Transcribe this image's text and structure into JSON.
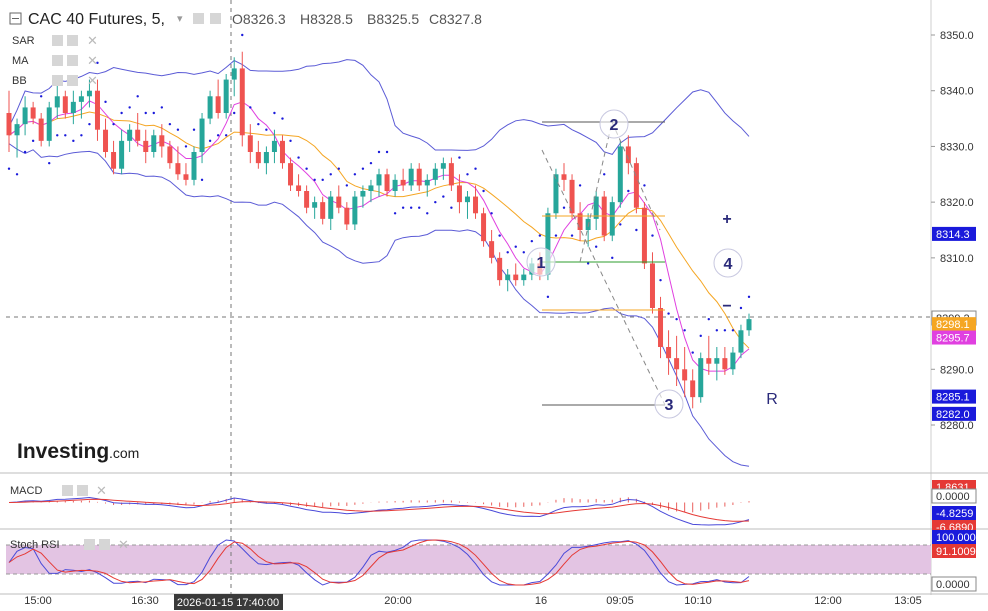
{
  "header": {
    "symbol": "CAC 40 Futures, 5,",
    "open": "O8326.3",
    "high": "H8328.5",
    "bid": "B8325.5",
    "close": "C8327.8"
  },
  "indicators": {
    "sar": "SAR",
    "ma": "MA",
    "bb": "BB",
    "macd": "MACD",
    "stoch": "Stoch RSI"
  },
  "logo": {
    "brand": "Investing",
    "suffix": ".com"
  },
  "price_axis": {
    "ticks": [
      "8350.0",
      "8340.0",
      "8330.0",
      "8320.0",
      "8310.0",
      "8290.0",
      "8280.0"
    ],
    "tick_values": [
      8350,
      8340,
      8330,
      8320,
      8310,
      8290,
      8280
    ],
    "tags": [
      {
        "label": "8314.3",
        "value": 8314.3,
        "color": "#1a1adb"
      },
      {
        "label": "8299.2",
        "value": 8299.2,
        "color": "#ffffff",
        "text": "#333333"
      },
      {
        "label": "8298.1",
        "value": 8298.1,
        "color": "#f5a623"
      },
      {
        "label": "8295.7",
        "value": 8295.7,
        "color": "#e040e0"
      },
      {
        "label": "8285.1",
        "value": 8285.1,
        "color": "#1a1adb"
      },
      {
        "label": "8282.0",
        "value": 8282.0,
        "color": "#1a1adb"
      }
    ]
  },
  "macd_axis": {
    "tags": [
      {
        "label": "1.8631",
        "color": "#e53935"
      },
      {
        "label": "0.0000",
        "color": "#ffffff",
        "text": "#333333"
      },
      {
        "label": "-4.8259",
        "color": "#1a1adb"
      },
      {
        "label": "-6.6890",
        "color": "#e53935"
      }
    ]
  },
  "stoch_axis": {
    "tags": [
      {
        "label": "100.0000",
        "color": "#1a1adb"
      },
      {
        "label": "91.1009",
        "color": "#e53935"
      },
      {
        "label": "0.0000",
        "color": "#ffffff",
        "text": "#333333"
      }
    ]
  },
  "time_axis": {
    "labels": [
      "15:00",
      "16:30",
      "18:00",
      "20:00",
      "16",
      "09:05",
      "10:10",
      "12:00",
      "13:05"
    ],
    "crosshair_label": "2026-01-15 17:40:00"
  },
  "annotations": {
    "wave_labels": [
      "1",
      "2",
      "3",
      "4"
    ],
    "plus": "+",
    "minus": "−",
    "r": "R"
  },
  "colors": {
    "up": "#26a69a",
    "down": "#ef5350",
    "bb": "#5b5bd6",
    "ma_orange": "#f5a623",
    "ma_pink": "#e040e0",
    "sar": "#1a1adb",
    "macd_line": "#4a4ad9",
    "signal_line": "#e53935",
    "stoch_fill": "#e3c4e3"
  },
  "chart_data": {
    "type": "candlestick",
    "y_range": [
      8274,
      8355
    ],
    "candles": [
      [
        8336,
        8340,
        8329,
        8332
      ],
      [
        8332,
        8335,
        8328,
        8334
      ],
      [
        8334,
        8339,
        8332,
        8337
      ],
      [
        8337,
        8338,
        8334,
        8335
      ],
      [
        8335,
        8336,
        8330,
        8331
      ],
      [
        8331,
        8338,
        8330,
        8337
      ],
      [
        8337,
        8341,
        8335,
        8339
      ],
      [
        8339,
        8340,
        8335,
        8336
      ],
      [
        8336,
        8340,
        8334,
        8338
      ],
      [
        8338,
        8340,
        8335,
        8339
      ],
      [
        8339,
        8342,
        8337,
        8340
      ],
      [
        8340,
        8342,
        8331,
        8333
      ],
      [
        8333,
        8335,
        8328,
        8329
      ],
      [
        8329,
        8331,
        8325,
        8326
      ],
      [
        8326,
        8333,
        8325,
        8331
      ],
      [
        8331,
        8334,
        8329,
        8333
      ],
      [
        8333,
        8336,
        8330,
        8331
      ],
      [
        8331,
        8333,
        8327,
        8329
      ],
      [
        8329,
        8333,
        8328,
        8332
      ],
      [
        8332,
        8334,
        8328,
        8330
      ],
      [
        8330,
        8331,
        8326,
        8327
      ],
      [
        8327,
        8330,
        8324,
        8325
      ],
      [
        8325,
        8327,
        8323,
        8324
      ],
      [
        8324,
        8330,
        8323,
        8329
      ],
      [
        8329,
        8336,
        8327,
        8335
      ],
      [
        8335,
        8340,
        8334,
        8339
      ],
      [
        8339,
        8342,
        8335,
        8336
      ],
      [
        8336,
        8343,
        8335,
        8342
      ],
      [
        8342,
        8346,
        8339,
        8344
      ],
      [
        8344,
        8347,
        8330,
        8332
      ],
      [
        8332,
        8334,
        8327,
        8329
      ],
      [
        8329,
        8331,
        8326,
        8327
      ],
      [
        8327,
        8330,
        8325,
        8329
      ],
      [
        8329,
        8333,
        8327,
        8331
      ],
      [
        8331,
        8332,
        8326,
        8327
      ],
      [
        8327,
        8328,
        8322,
        8323
      ],
      [
        8323,
        8325,
        8321,
        8322
      ],
      [
        8322,
        8323,
        8318,
        8319
      ],
      [
        8319,
        8321,
        8317,
        8320
      ],
      [
        8320,
        8321,
        8316,
        8317
      ],
      [
        8317,
        8322,
        8315,
        8321
      ],
      [
        8321,
        8323,
        8318,
        8319
      ],
      [
        8319,
        8320,
        8315,
        8316
      ],
      [
        8316,
        8322,
        8315,
        8321
      ],
      [
        8321,
        8323,
        8319,
        8322
      ],
      [
        8322,
        8324,
        8320,
        8323
      ],
      [
        8323,
        8326,
        8321,
        8325
      ],
      [
        8325,
        8326,
        8321,
        8322
      ],
      [
        8322,
        8325,
        8321,
        8324
      ],
      [
        8324,
        8326,
        8322,
        8323
      ],
      [
        8323,
        8327,
        8322,
        8326
      ],
      [
        8326,
        8327,
        8322,
        8323
      ],
      [
        8323,
        8325,
        8321,
        8324
      ],
      [
        8324,
        8327,
        8323,
        8326
      ],
      [
        8326,
        8328,
        8324,
        8327
      ],
      [
        8327,
        8328,
        8322,
        8323
      ],
      [
        8323,
        8325,
        8318,
        8320
      ],
      [
        8320,
        8322,
        8317,
        8321
      ],
      [
        8321,
        8323,
        8317,
        8318
      ],
      [
        8318,
        8319,
        8312,
        8313
      ],
      [
        8313,
        8315,
        8309,
        8310
      ],
      [
        8310,
        8311,
        8305,
        8306
      ],
      [
        8306,
        8308,
        8304,
        8307
      ],
      [
        8307,
        8309,
        8305,
        8306
      ],
      [
        8306,
        8308,
        8305,
        8307
      ],
      [
        8307,
        8310,
        8306,
        8309
      ],
      [
        8309,
        8311,
        8306,
        8307
      ],
      [
        8307,
        8319,
        8306,
        8318
      ],
      [
        8318,
        8326,
        8317,
        8325
      ],
      [
        8325,
        8327,
        8322,
        8324
      ],
      [
        8324,
        8325,
        8317,
        8318
      ],
      [
        8318,
        8320,
        8313,
        8315
      ],
      [
        8315,
        8318,
        8312,
        8317
      ],
      [
        8317,
        8322,
        8315,
        8321
      ],
      [
        8321,
        8322,
        8313,
        8314
      ],
      [
        8314,
        8321,
        8313,
        8320
      ],
      [
        8320,
        8331,
        8319,
        8330
      ],
      [
        8330,
        8332,
        8325,
        8327
      ],
      [
        8327,
        8328,
        8318,
        8319
      ],
      [
        8319,
        8320,
        8308,
        8309
      ],
      [
        8309,
        8311,
        8300,
        8301
      ],
      [
        8301,
        8303,
        8292,
        8294
      ],
      [
        8294,
        8297,
        8289,
        8292
      ],
      [
        8292,
        8296,
        8287,
        8290
      ],
      [
        8290,
        8294,
        8285,
        8288
      ],
      [
        8288,
        8290,
        8283,
        8285
      ],
      [
        8285,
        8293,
        8284,
        8292
      ],
      [
        8292,
        8296,
        8289,
        8291
      ],
      [
        8291,
        8294,
        8288,
        8292
      ],
      [
        8292,
        8294,
        8289,
        8290
      ],
      [
        8290,
        8294,
        8289,
        8293
      ],
      [
        8293,
        8298,
        8292,
        8297
      ],
      [
        8297,
        8300,
        8296,
        8299
      ]
    ]
  }
}
